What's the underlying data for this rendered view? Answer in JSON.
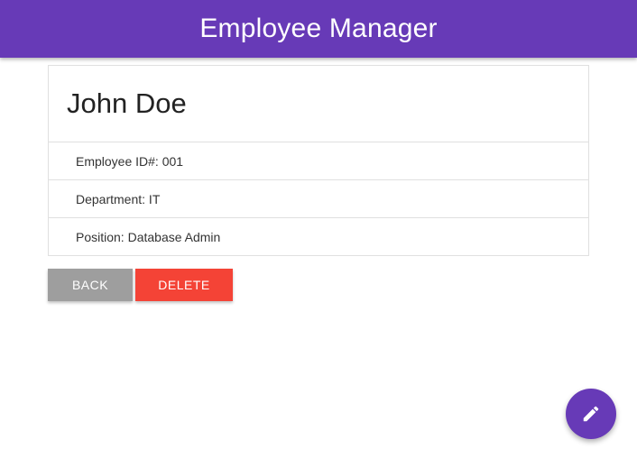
{
  "app": {
    "title": "Employee Manager",
    "primary_color": "#673ab7"
  },
  "employee": {
    "name": "John Doe",
    "details": [
      "Employee ID#: 001",
      "Department: IT",
      "Position: Database Admin"
    ]
  },
  "actions": {
    "back_label": "BACK",
    "back_color": "#9e9e9e",
    "delete_label": "DELETE",
    "delete_color": "#f44336"
  },
  "fab": {
    "icon": "pencil-icon"
  }
}
